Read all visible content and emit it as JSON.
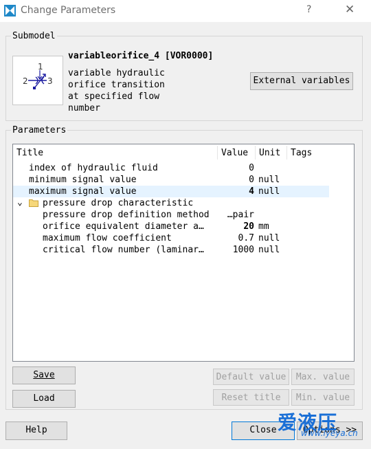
{
  "window": {
    "title": "Change Parameters",
    "help_glyph": "?",
    "close_glyph": "✕"
  },
  "submodel": {
    "group_label": "Submodel",
    "name": "variableorifice_4 [VOR0000]",
    "description": [
      "variable hydraulic",
      "orifice transition",
      "at specified flow",
      "number"
    ],
    "icon_ports": [
      "1",
      "2",
      "3"
    ],
    "external_variables_label": "External variables"
  },
  "parameters": {
    "group_label": "Parameters",
    "columns": [
      "Title",
      "Value",
      "Unit",
      "Tags"
    ],
    "rows": [
      {
        "title": "index of hydraulic fluid",
        "value": "0",
        "unit": "",
        "level": 0,
        "selected": false,
        "bold": false,
        "folder": false
      },
      {
        "title": "minimum signal value",
        "value": "0",
        "unit": "null",
        "level": 0,
        "selected": false,
        "bold": false,
        "folder": false
      },
      {
        "title": "maximum signal value",
        "value": "4",
        "unit": "null",
        "level": 0,
        "selected": true,
        "bold": true,
        "folder": false
      },
      {
        "title": "pressure drop characteristic",
        "value": "",
        "unit": "",
        "level": 0,
        "selected": false,
        "bold": false,
        "folder": true
      },
      {
        "title": "pressure drop definition method",
        "value": "…pair",
        "unit": "",
        "level": 1,
        "selected": false,
        "bold": false,
        "folder": false
      },
      {
        "title": "orifice equivalent diameter a…",
        "value": "20",
        "unit": "mm",
        "level": 1,
        "selected": false,
        "bold": true,
        "folder": false
      },
      {
        "title": "maximum flow coefficient",
        "value": "0.7",
        "unit": "null",
        "level": 1,
        "selected": false,
        "bold": false,
        "folder": false
      },
      {
        "title": "critical flow number (laminar…",
        "value": "1000",
        "unit": "null",
        "level": 1,
        "selected": false,
        "bold": false,
        "folder": false
      }
    ]
  },
  "buttons": {
    "save": "Save",
    "load": "Load",
    "default_value": "Default value",
    "max_value": "Max. value",
    "reset_title": "Reset title",
    "min_value": "Min. value",
    "help": "Help",
    "close": "Close",
    "options": "Options >>"
  },
  "watermark": {
    "brand": "爱液压",
    "url": "www.iyeya.cn"
  },
  "colors": {
    "selection": "#e5f3ff",
    "accent": "#0078d7",
    "watermark": "#1a6fd6"
  }
}
